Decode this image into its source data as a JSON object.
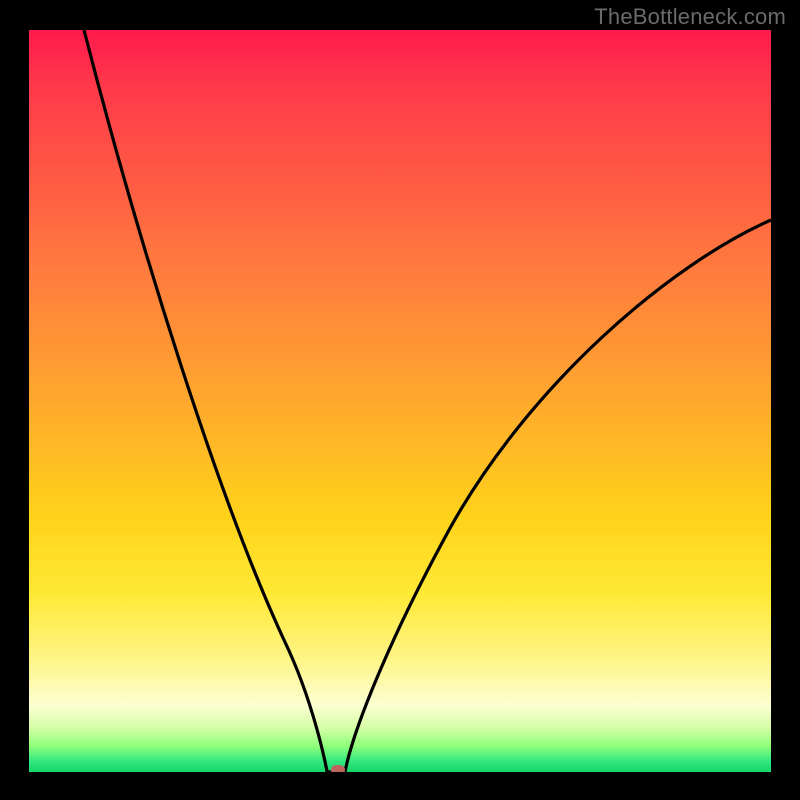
{
  "watermark": "TheBottleneck.com",
  "chart_data": {
    "type": "line",
    "title": "",
    "xlabel": "",
    "ylabel": "",
    "xlim": [
      0,
      100
    ],
    "ylim": [
      0,
      100
    ],
    "grid": false,
    "legend": false,
    "series": [
      {
        "name": "left-branch",
        "x": [
          7.5,
          12,
          16,
          20,
          24,
          28,
          31.5,
          34.5,
          37,
          38.8,
          39.6,
          40.2,
          40.2
        ],
        "y": [
          100,
          82,
          66,
          52,
          38,
          26,
          16.5,
          9,
          4,
          1.2,
          0.4,
          0.1,
          0
        ]
      },
      {
        "name": "right-branch",
        "x": [
          42.8,
          44,
          46,
          49,
          52.5,
          57,
          62,
          68,
          74,
          81,
          88,
          95,
          100
        ],
        "y": [
          0,
          3,
          8.5,
          16,
          24,
          32.5,
          40,
          47.5,
          54,
          60.5,
          66,
          71,
          74.5
        ]
      }
    ],
    "marker": {
      "x": 41.7,
      "y": 0
    },
    "colors": {
      "curve": "#000000",
      "marker": "#bd665d",
      "gradient_top": "#ff1a4d",
      "gradient_bottom": "#16d46c"
    }
  }
}
